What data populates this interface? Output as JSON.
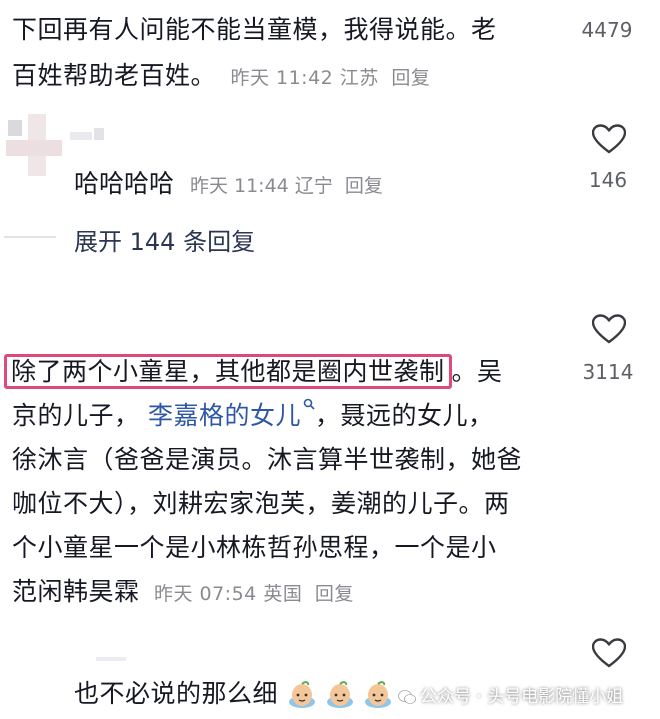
{
  "comment1": {
    "line1": "下回再有人问能不能当童模，我得说能。老",
    "line2": "百姓帮助老百姓。",
    "time": "昨天 11:42",
    "location": "江苏",
    "reply": "回复",
    "likes": "4479"
  },
  "comment2": {
    "username_text": "哈哈哈哈",
    "time": "昨天 11:44",
    "location": "辽宁",
    "reply": "回复",
    "likes": "146",
    "expand_label": "展开 144 条回复"
  },
  "comment3": {
    "highlight_text": "除了两个小童星，其他都是圈内世袭制",
    "line1_tail": "。吴",
    "line2_a": "京的儿子，",
    "line2_link": "李嘉格的女儿",
    "line2_b": "，聂远的女儿，",
    "line3": "徐沐言（爸爸是演员。沐言算半世袭制，她爸",
    "line4": "咖位不大），刘耕宏家泡芙，姜潮的儿子。两",
    "line5": "个小童星一个是小林栋哲孙思程，一个是小",
    "line6": "范闲韩昊霖",
    "time": "昨天 07:54",
    "location": "英国",
    "reply": "回复",
    "likes": "3114"
  },
  "comment4": {
    "text": "也不必说的那么细"
  },
  "watermark": {
    "text": "公众号 · 头号电影院懂小姐"
  },
  "colors": {
    "highlight_border": "#e0487a",
    "link": "#2e58a6",
    "meta": "#8a8b91"
  }
}
